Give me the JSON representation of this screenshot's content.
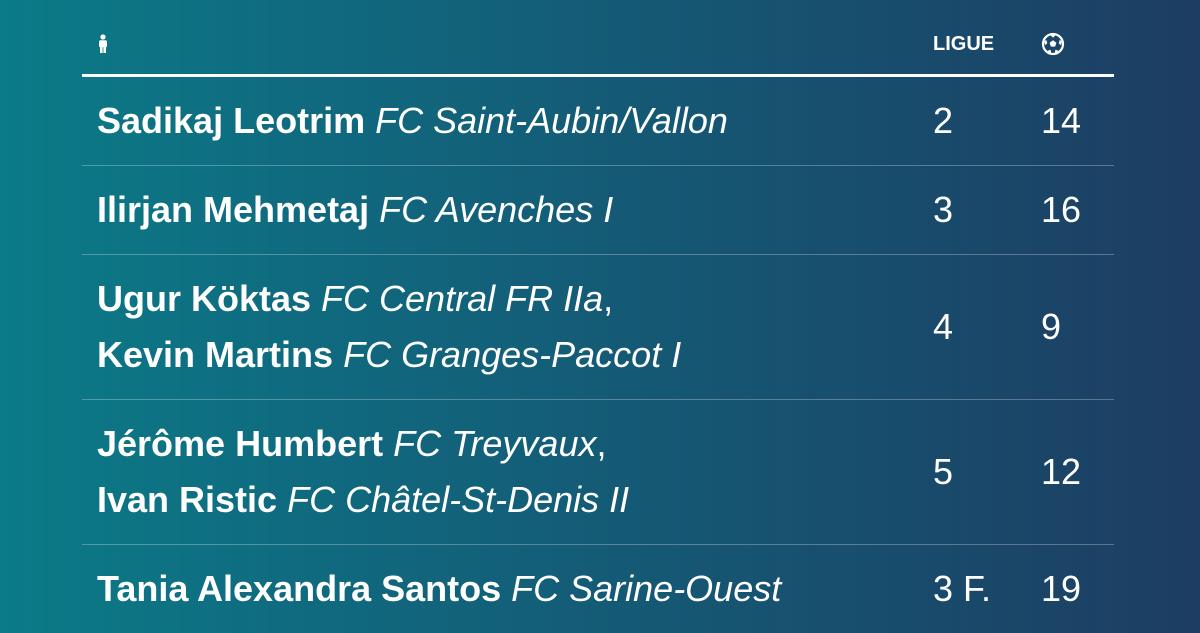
{
  "header": {
    "person_icon": "person-icon",
    "ligue_label": "LIGUE",
    "goals_icon": "soccer-ball-icon"
  },
  "rows": [
    {
      "players": [
        {
          "name": "Sadikaj Leotrim",
          "club": "FC Saint-Aubin/Vallon",
          "sep": ""
        }
      ],
      "ligue": "2",
      "goals": "14"
    },
    {
      "players": [
        {
          "name": "Ilirjan Mehmetaj",
          "club": "FC Avenches I",
          "sep": ""
        }
      ],
      "ligue": "3",
      "goals": "16"
    },
    {
      "players": [
        {
          "name": "Ugur Köktas",
          "club": "FC Central FR IIa",
          "sep": ","
        },
        {
          "name": "Kevin Martins",
          "club": "FC Granges-Paccot I",
          "sep": ""
        }
      ],
      "ligue": "4",
      "goals": "9"
    },
    {
      "players": [
        {
          "name": "Jérôme Humbert",
          "club": "FC Treyvaux",
          "sep": ","
        },
        {
          "name": "Ivan Ristic",
          "club": "FC Châtel-St-Denis II",
          "sep": ""
        }
      ],
      "ligue": "5",
      "goals": "12"
    },
    {
      "players": [
        {
          "name": "Tania Alexandra Santos",
          "club": "FC Sarine-Ouest",
          "sep": ""
        }
      ],
      "ligue": "3 F.",
      "goals": "19"
    }
  ]
}
